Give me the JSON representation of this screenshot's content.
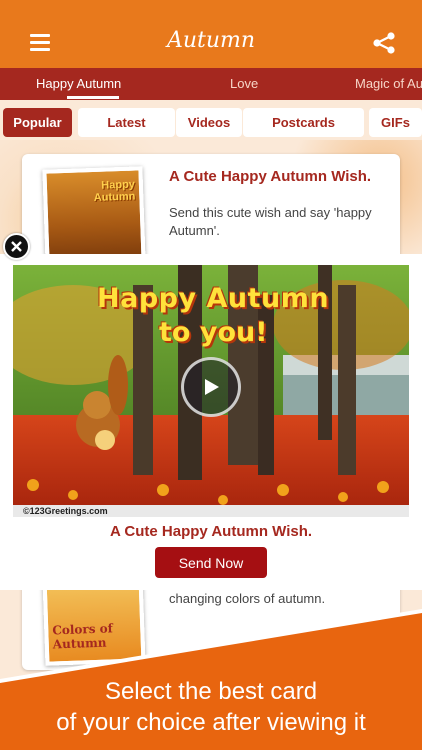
{
  "header": {
    "title": "Autumn",
    "menu_icon": "hamburger-icon",
    "share_icon": "share-icon"
  },
  "categories": [
    {
      "label": "Happy Autumn",
      "active": true
    },
    {
      "label": "Love",
      "active": false
    },
    {
      "label": "Magic of Au",
      "active": false
    }
  ],
  "filters": [
    {
      "label": "Popular",
      "active": true
    },
    {
      "label": "Latest",
      "active": false
    },
    {
      "label": "Videos",
      "active": false
    },
    {
      "label": "Postcards",
      "active": false
    },
    {
      "label": "GIFs",
      "active": false
    }
  ],
  "cards": [
    {
      "title": "A Cute Happy Autumn Wish.",
      "description": "Send this cute wish and say 'happy Autumn'.",
      "thumb_text": "Happy Autumn"
    },
    {
      "description": "May your life blossom with the ever changing colors of autumn.",
      "thumb_text": "Colors of Autumn"
    }
  ],
  "popup": {
    "video_text_line1": "Happy Autumn",
    "video_text_line2": "to you!",
    "watermark": "©123Greetings.com",
    "title": "A Cute Happy Autumn Wish.",
    "button_label": "Send Now"
  },
  "banner": {
    "line1": "Select the best card",
    "line2": "of your choice after viewing it"
  },
  "colors": {
    "header": "#e8791c",
    "category_bar": "#a5281f",
    "accent": "#a50f12",
    "banner": "#e8650f"
  }
}
